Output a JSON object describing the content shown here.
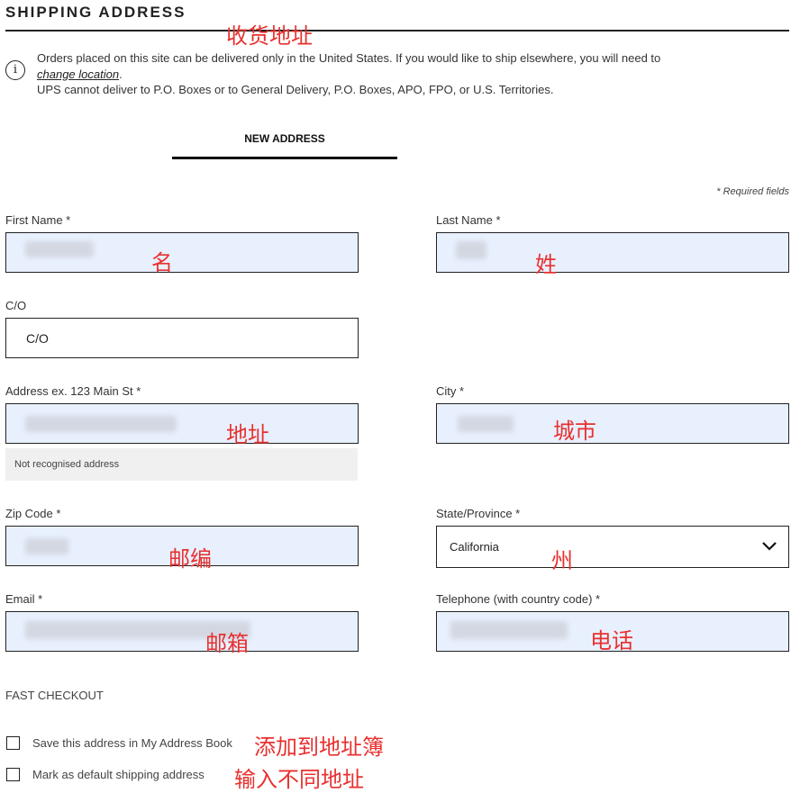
{
  "section_title": "SHIPPING ADDRESS",
  "notice": {
    "line1": "Orders placed on this site can be delivered only in the United States. If you would like to ship elsewhere, you will need to",
    "link": "change location",
    "after_link": ".",
    "line2": "UPS cannot deliver to P.O. Boxes or to General Delivery, P.O. Boxes, APO, FPO, or U.S. Territories."
  },
  "tab": {
    "label": "NEW ADDRESS"
  },
  "required_note": "* Required fields",
  "fields": {
    "first_name": {
      "label": "First Name *",
      "value": ""
    },
    "last_name": {
      "label": "Last Name *",
      "value": ""
    },
    "co": {
      "label": "C/O",
      "value": "C/O"
    },
    "address": {
      "label": "Address ex. 123 Main St *",
      "value": "",
      "hint": "Not recognised address"
    },
    "city": {
      "label": "City *",
      "value": ""
    },
    "zip": {
      "label": "Zip Code *",
      "value": ""
    },
    "state": {
      "label": "State/Province *",
      "value": "California"
    },
    "email": {
      "label": "Email *",
      "value": ""
    },
    "telephone": {
      "label": "Telephone (with country code) *",
      "value": ""
    }
  },
  "fast_checkout": {
    "title": "FAST CHECKOUT",
    "options": [
      {
        "label": "Save this address in My Address Book",
        "checked": false
      },
      {
        "label": "Mark as default shipping address",
        "checked": false
      }
    ]
  },
  "annotations": {
    "shipping": "收货地址",
    "first_name": "名",
    "last_name": "姓",
    "address": "地址",
    "city": "城市",
    "zip": "邮编",
    "state": "州",
    "email": "邮箱",
    "telephone": "电话",
    "save_book": "添加到地址簿",
    "different_address": "输入不同地址"
  },
  "colors": {
    "annotation": "#e8312f",
    "autofill_bg": "#e8f0fe",
    "border": "#222222"
  }
}
